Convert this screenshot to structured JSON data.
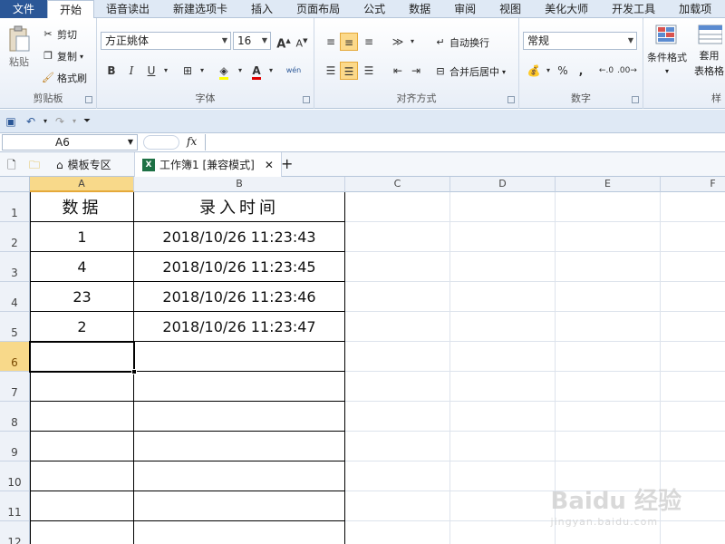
{
  "ribbon_tabs": [
    "文件",
    "开始",
    "语音读出",
    "新建选项卡",
    "插入",
    "页面布局",
    "公式",
    "数据",
    "审阅",
    "视图",
    "美化大师",
    "开发工具",
    "加载项"
  ],
  "clipboard": {
    "label": "剪贴板",
    "paste": "粘贴",
    "cut": "剪切",
    "copy": "复制",
    "format_painter": "格式刷"
  },
  "font": {
    "label": "字体",
    "family": "方正姚体",
    "size": "16",
    "bold": "B",
    "italic": "I",
    "underline": "U",
    "grow": "A",
    "shrink": "A",
    "color_a": "A",
    "wen": "wén"
  },
  "alignment": {
    "label": "对齐方式",
    "wrap_text": "自动换行",
    "merge_center": "合并后居中"
  },
  "number": {
    "label": "数字",
    "format": "常规",
    "percent": "%",
    "comma": ","
  },
  "styles": {
    "conditional_format": "条件格式",
    "table_format_line1": "套用",
    "table_format_line2": "表格格",
    "label": "样"
  },
  "name_box": "A6",
  "fx_label": "fx",
  "doc_tabs": {
    "templates": "模板专区",
    "workbook": "工作簿1 [兼容模式]",
    "close": "✕",
    "add": "+"
  },
  "columns": [
    "A",
    "B",
    "C",
    "D",
    "E",
    "F"
  ],
  "rows": [
    "1",
    "2",
    "3",
    "4",
    "5",
    "6",
    "7",
    "8",
    "9",
    "10",
    "11",
    "12"
  ],
  "sheet": {
    "header_a": "数据",
    "header_b": "录入时间",
    "entries": [
      {
        "value": "1",
        "time": "2018/10/26 11:23:43"
      },
      {
        "value": "4",
        "time": "2018/10/26 11:23:45"
      },
      {
        "value": "23",
        "time": "2018/10/26 11:23:46"
      },
      {
        "value": "2",
        "time": "2018/10/26 11:23:47"
      }
    ]
  },
  "watermark": {
    "brand": "Baidu 经验",
    "url": "jingyan.baidu.com"
  }
}
